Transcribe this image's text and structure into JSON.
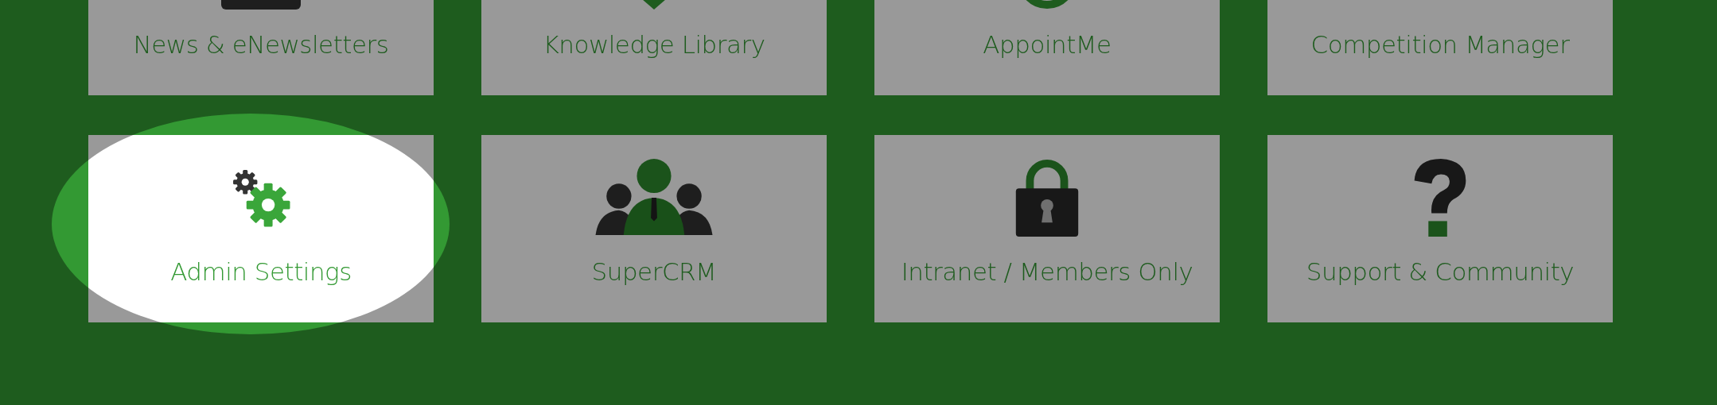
{
  "tiles": [
    {
      "label": "News & eNewsletters",
      "kind": "tablet",
      "highlighted": false
    },
    {
      "label": "Knowledge Library",
      "kind": "marker",
      "highlighted": false
    },
    {
      "label": "AppointMe",
      "kind": "ring",
      "highlighted": false
    },
    {
      "label": "Competition Manager",
      "highlighted": false
    },
    {
      "label": "Admin Settings",
      "kind": "gears",
      "highlighted": true
    },
    {
      "label": "SuperCRM",
      "kind": "people",
      "highlighted": false
    },
    {
      "label": "Intranet / Members Only",
      "kind": "lock",
      "highlighted": false
    },
    {
      "label": "Support & Community",
      "kind": "question",
      "highlighted": false
    }
  ]
}
